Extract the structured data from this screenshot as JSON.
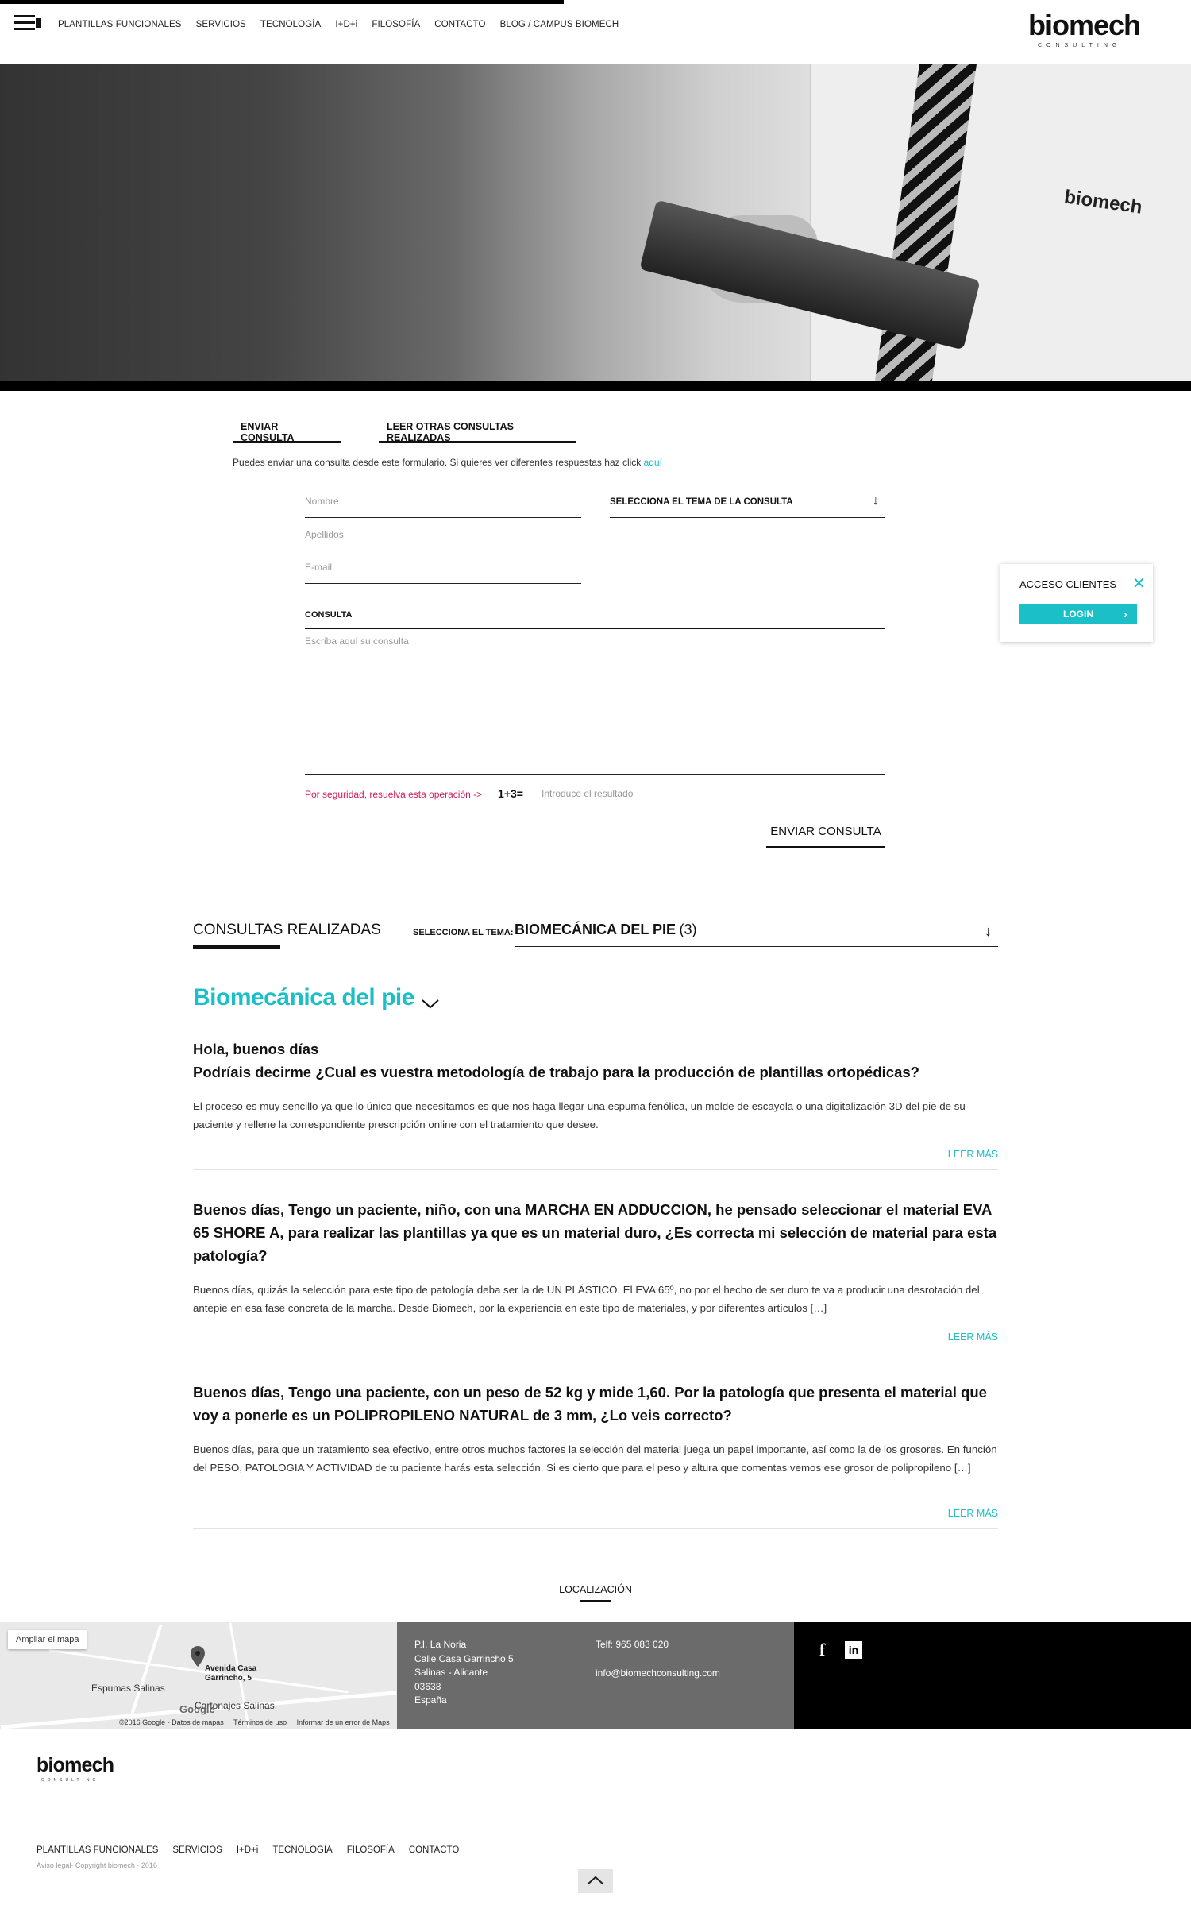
{
  "header": {
    "nav": [
      "PLANTILLAS FUNCIONALES",
      "SERVICIOS",
      "TECNOLOGÍA",
      "I+D+i",
      "FILOSOFÍA",
      "CONTACTO",
      "BLOG / CAMPUS BIOMECH"
    ],
    "logo_text": "biomech",
    "logo_sub": "CONSULTING"
  },
  "hero": {
    "pocket_logo": "biomech"
  },
  "tabs": {
    "enviar": "ENVIAR CONSULTA",
    "leer": "LEER OTRAS CONSULTAS REALIZADAS"
  },
  "intro": {
    "text": "Puedes enviar una consulta desde este formulario. Si quieres ver diferentes respuestas haz click ",
    "link": "aquí"
  },
  "form": {
    "nombre_placeholder": "Nombre",
    "apellidos_placeholder": "Apellidos",
    "email_placeholder": "E-mail",
    "tema_label": "SELECCIONA EL TEMA DE LA CONSULTA",
    "tema_arrow": "↓",
    "consulta_label": "CONSULTA",
    "consulta_placeholder": "Escriba aquí su consulta",
    "captcha_label": "Por seguridad, resuelva esta operación ->",
    "captcha_op": "1+3=",
    "captcha_placeholder": "Introduce el resultado",
    "submit_label": "ENVIAR CONSULTA"
  },
  "client_box": {
    "title": "ACCESO CLIENTES",
    "close": "✕",
    "login": "LOGIN",
    "login_chevron": "›"
  },
  "consultas": {
    "title": "CONSULTAS REALIZADAS",
    "tema_label": "SELECCIONA EL TEMA:",
    "selected": "BIOMECÁNICA DEL PIE",
    "count": "(3)",
    "arrow": "↓",
    "category_title": "Biomecánica del pie",
    "read_more": "LEER MÁS",
    "items": [
      {
        "question": "Hola, buenos días\nPodríais decirme ¿Cual es vuestra metodología de trabajo para la producción de plantillas ortopédicas?",
        "answer": "El proceso es muy sencillo ya que lo único que necesitamos es que nos haga llegar una espuma fenólica, un molde de escayola o una digitalización 3D del pie de su paciente y rellene la correspondiente prescripción online con el tratamiento que desee."
      },
      {
        "question": "Buenos días, Tengo un paciente, niño, con una MARCHA EN ADDUCCION, he pensado seleccionar el material EVA 65 SHORE A, para realizar las plantillas ya que es un material duro, ¿Es correcta mi selección de material para esta patología?",
        "answer": "Buenos días, quizás la selección para este tipo de patología deba ser la de UN PLÁSTICO. El EVA 65º, no por el hecho de ser duro te va a producir una desrotación del antepie en esa fase concreta de la marcha. Desde Biomech, por la experiencia en este tipo de materiales, y por diferentes artículos […]"
      },
      {
        "question": "Buenos días, Tengo una paciente, con un peso de 52 kg y mide 1,60. Por la patología que presenta el material que voy a ponerle es un POLIPROPILENO NATURAL de 3 mm, ¿Lo veis correcto?",
        "answer": "Buenos días, para que un tratamiento sea efectivo, entre otros muchos factores la selección del material juega un papel importante, así como la de los grosores. En función del PESO, PATOLOGIA Y ACTIVIDAD de tu paciente harás esta selección. Si es cierto que para el peso y altura que comentas vemos ese grosor de polipropileno […]"
      }
    ]
  },
  "location": {
    "title": "LOCALIZACIÓN",
    "map": {
      "ampliar": "Ampliar el mapa",
      "pin_address": "Avenida Casa\nGarrincho, 5",
      "label1": "Espumas Salinas",
      "label2": "Cartonajes Salinas,",
      "google": "Google",
      "footer": "©2016 Google - Datos de mapas     Términos de uso     Informar de un error de Maps"
    },
    "address": [
      "P.I. La Noria",
      "Calle Casa Garrincho 5",
      "Salinas - Alicante",
      "03638",
      "España"
    ],
    "phone": "Telf: 965 083 020",
    "email": "info@biomechconsulting.com",
    "social": {
      "facebook": "f",
      "linkedin": "in"
    }
  },
  "footer": {
    "logo_text": "biomech",
    "logo_sub": "CONSULTING",
    "nav": [
      "PLANTILLAS FUNCIONALES",
      "SERVICIOS",
      "I+D+i",
      "TECNOLOGÍA",
      "FILOSOFÍA",
      "CONTACTO"
    ],
    "copyright": "Aviso legal· Copyright biomech · 2016"
  },
  "colors": {
    "accent": "#1bbfc7",
    "captcha": "#d11d5a",
    "address_bg": "#6b6b6b"
  }
}
